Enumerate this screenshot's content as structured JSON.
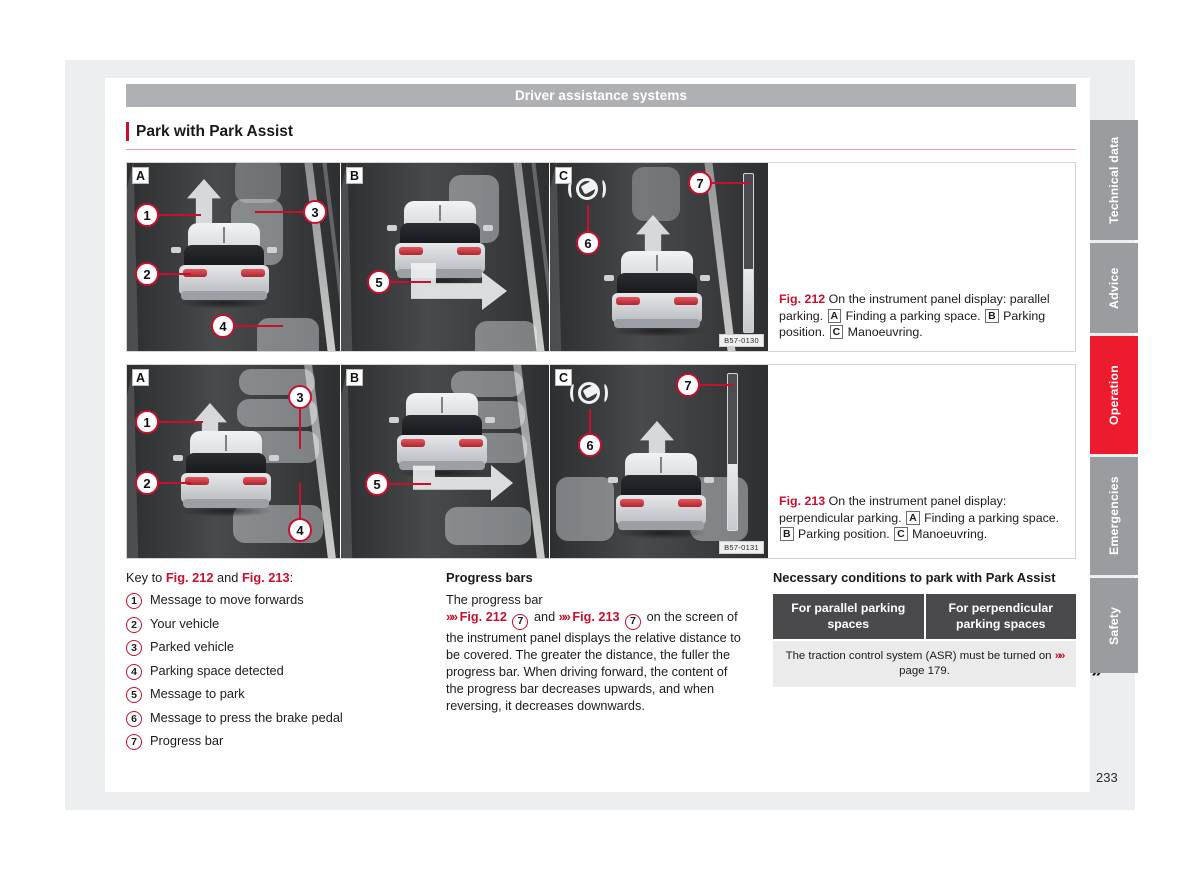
{
  "header": {
    "chapter": "Driver assistance systems",
    "section_title": "Park with Park Assist"
  },
  "figures": [
    {
      "id": "fig-212",
      "image_code": "B57-0130",
      "panels": [
        {
          "letter": "A",
          "callouts": [
            "1",
            "2",
            "3",
            "4"
          ]
        },
        {
          "letter": "B",
          "callouts": [
            "5"
          ]
        },
        {
          "letter": "C",
          "callouts": [
            "6",
            "7"
          ]
        }
      ],
      "caption_label": "Fig. 212",
      "caption_text_1": "On the instrument panel display: parallel parking.",
      "caption_badge_a": "A",
      "caption_text_2": "Finding a parking space.",
      "caption_badge_b": "B",
      "caption_text_3": "Parking position.",
      "caption_badge_c": "C",
      "caption_text_4": "Manoeuvring."
    },
    {
      "id": "fig-213",
      "image_code": "B57-0131",
      "panels": [
        {
          "letter": "A",
          "callouts": [
            "1",
            "2",
            "3",
            "4"
          ]
        },
        {
          "letter": "B",
          "callouts": [
            "5"
          ]
        },
        {
          "letter": "C",
          "callouts": [
            "6",
            "7"
          ]
        }
      ],
      "caption_label": "Fig. 213",
      "caption_text_1": "On the instrument panel display: perpendicular parking.",
      "caption_badge_a": "A",
      "caption_text_2": "Finding a parking space.",
      "caption_badge_b": "B",
      "caption_text_3": "Parking position.",
      "caption_badge_c": "C",
      "caption_text_4": "Manoeuvring."
    }
  ],
  "key_column": {
    "heading_prefix": "Key to ",
    "heading_fig1": "Fig. 212",
    "heading_and": " and ",
    "heading_fig2": "Fig. 213",
    "heading_suffix": ":",
    "items": [
      {
        "num": "1",
        "label": "Message to move forwards"
      },
      {
        "num": "2",
        "label": "Your vehicle"
      },
      {
        "num": "3",
        "label": "Parked vehicle"
      },
      {
        "num": "4",
        "label": "Parking space detected"
      },
      {
        "num": "5",
        "label": "Message to park"
      },
      {
        "num": "6",
        "label": "Message to press the brake pedal"
      },
      {
        "num": "7",
        "label": "Progress bar"
      }
    ]
  },
  "progress_column": {
    "heading": "Progress bars",
    "text_part_1": "The progress bar ",
    "ref1_chevron": "»»",
    "ref1_fig": "Fig. 212",
    "ref1_num": "7",
    "text_and": " and ",
    "ref2_chevron": "»»",
    "ref2_fig": "Fig. 213",
    "ref2_num": "7",
    "text_part_2": " on the screen of the instrument panel displays the relative distance to be covered. The greater the distance, the fuller the progress bar. When driving forward, the content of the progress bar decreases upwards, and when reversing, it decreases downwards."
  },
  "conditions_column": {
    "heading": "Necessary conditions to park with Park Assist",
    "table": {
      "headers": [
        "For parallel parking spaces",
        "For perpendicular parking spaces"
      ],
      "body_text": "The traction control system (ASR) must be turned on",
      "body_ref_chevron": "»»",
      "body_ref_page": "page 179."
    },
    "continuation_arrow": "»"
  },
  "side_tabs": [
    {
      "label": "Technical data",
      "active": false
    },
    {
      "label": "Advice",
      "active": false
    },
    {
      "label": "Operation",
      "active": true
    },
    {
      "label": "Emergencies",
      "active": false
    },
    {
      "label": "Safety",
      "active": false
    }
  ],
  "page_number": "233",
  "colors": {
    "brand_red": "#c8102e",
    "tab_active_red": "#ed1b2e",
    "tab_grey": "#9a9ca0",
    "chapter_bar_grey": "#aeb0b3",
    "table_header_dark": "#4a4a4c"
  }
}
